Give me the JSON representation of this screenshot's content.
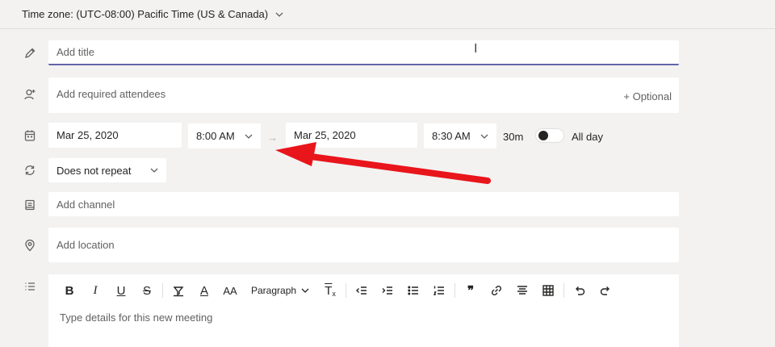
{
  "timezone": {
    "label": "Time zone: (UTC-08:00) Pacific Time (US & Canada)"
  },
  "title": {
    "placeholder": "Add title"
  },
  "attendees": {
    "placeholder": "Add required attendees",
    "optional_label": "+ Optional"
  },
  "schedule": {
    "start_date": "Mar 25, 2020",
    "start_time": "8:00 AM",
    "arrow": "→",
    "end_date": "Mar 25, 2020",
    "end_time": "8:30 AM",
    "duration": "30m",
    "all_day_label": "All day",
    "all_day": false
  },
  "repeat": {
    "value": "Does not repeat"
  },
  "channel": {
    "placeholder": "Add channel"
  },
  "location": {
    "placeholder": "Add location"
  },
  "editor": {
    "toolbar": {
      "bold": "B",
      "italic": "I",
      "underline": "U",
      "strikethrough": "S",
      "font_color": "A",
      "font_size": "AA",
      "paragraph": "Paragraph",
      "clear_format": "T",
      "quote": "❞"
    },
    "placeholder": "Type details for this new meeting"
  },
  "colors": {
    "accent": "#6264a7",
    "annotation_arrow": "#e8151b",
    "background": "#f3f2f1"
  }
}
